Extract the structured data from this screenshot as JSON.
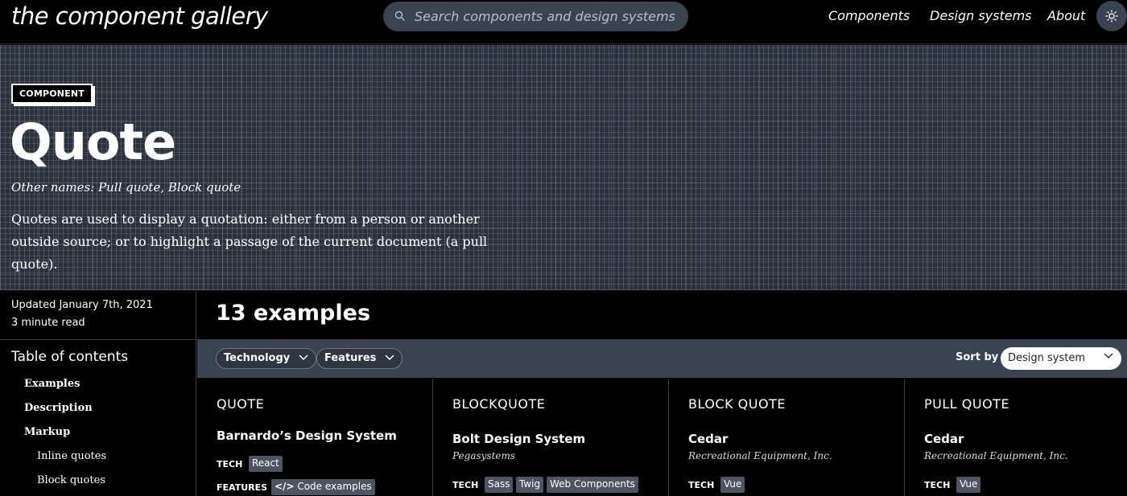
{
  "header": {
    "logo": "the component gallery",
    "search_placeholder": "Search components and design systems",
    "nav": [
      "Components",
      "Design systems",
      "About"
    ]
  },
  "hero": {
    "badge": "COMPONENT",
    "title": "Quote",
    "aliases": "Other names: Pull quote, Block quote",
    "description": "Quotes are used to display a quotation: either from a person or another outside source; or to highlight a passage of the current document (a pull quote)."
  },
  "sidebar": {
    "updated": "Updated January 7th, 2021",
    "read_time": "3 minute read",
    "toc_title": "Table of contents",
    "toc": [
      "Examples",
      "Description",
      "Markup",
      "Inline quotes",
      "Block quotes"
    ]
  },
  "main": {
    "count": "13 examples",
    "filters": [
      "Technology",
      "Features"
    ],
    "sort_label": "Sort by",
    "sort_value": "Design system"
  },
  "cards": [
    {
      "name": "QUOTE",
      "system": "Barnardo’s Design System",
      "org": "",
      "tech_label": "TECH",
      "tech": [
        "React"
      ],
      "features_label": "FEATURES",
      "features": [
        "Code examples"
      ]
    },
    {
      "name": "BLOCKQUOTE",
      "system": "Bolt Design System",
      "org": "Pegasystems",
      "tech_label": "TECH",
      "tech": [
        "Sass",
        "Twig",
        "Web Components"
      ]
    },
    {
      "name": "BLOCK QUOTE",
      "system": "Cedar",
      "org": "Recreational Equipment, Inc.",
      "tech_label": "TECH",
      "tech": [
        "Vue"
      ]
    },
    {
      "name": "PULL QUOTE",
      "system": "Cedar",
      "org": "Recreational Equipment, Inc.",
      "tech_label": "TECH",
      "tech": [
        "Vue"
      ]
    }
  ],
  "colors": {
    "accent_bg": "#3b4350",
    "tag_bg": "#4d5562"
  }
}
